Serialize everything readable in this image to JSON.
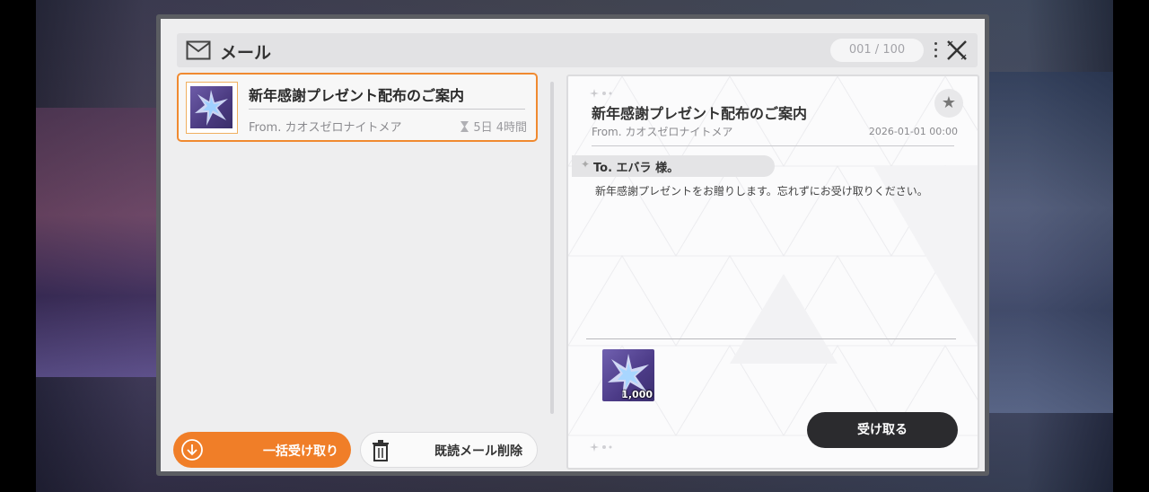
{
  "header": {
    "title": "メール",
    "count": "001 / 100"
  },
  "mail_list": [
    {
      "title": "新年感謝プレゼント配布のご案内",
      "from": "From. カオスゼロナイトメア",
      "time_left": "5日 4時間",
      "selected": true
    }
  ],
  "actions": {
    "claim_all": "一括受け取り",
    "delete_read": "既読メール削除"
  },
  "detail": {
    "title": "新年感謝プレゼント配布のご案内",
    "from": "From. カオスゼロナイトメア",
    "date": "2026-01-01 00:00",
    "to": "To. エバラ 様。",
    "body": "新年感謝プレゼントをお贈りします。忘れずにお受け取りください。",
    "reward_qty": "1,000",
    "receive": "受け取る"
  },
  "colors": {
    "accent": "#f07e28",
    "dark_button": "#2b2b2e",
    "selection_border": "#f08a30"
  },
  "icons": [
    "mail-icon",
    "kebab-menu-icon",
    "close-icon",
    "crystal-item-icon",
    "hourglass-icon",
    "download-icon",
    "trash-icon",
    "star-icon"
  ]
}
